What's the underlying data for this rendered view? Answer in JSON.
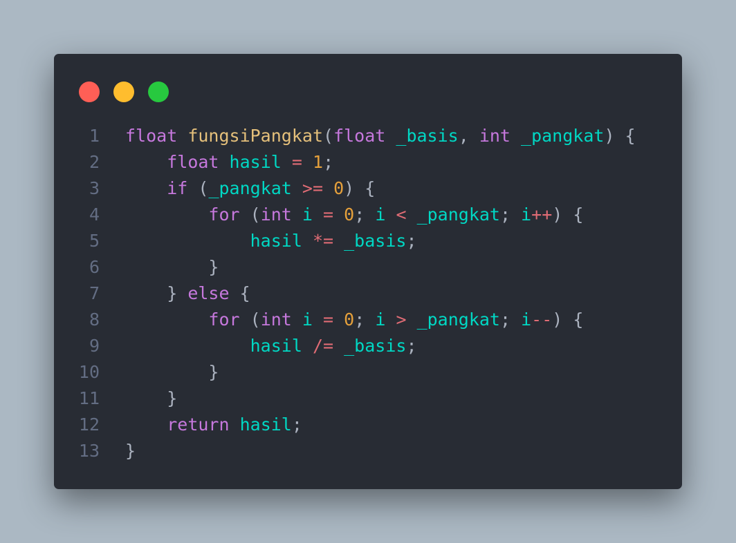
{
  "window": {
    "controls": [
      {
        "name": "close-button",
        "color": "#ff5f56"
      },
      {
        "name": "minimize-button",
        "color": "#ffbd2e"
      },
      {
        "name": "maximize-button",
        "color": "#27c93f"
      }
    ]
  },
  "colors": {
    "keyword": "#c678dd",
    "function": "#e5c07b",
    "identifier": "#00d8c4",
    "operator": "#e06c75",
    "number": "#e5a03b",
    "punct": "#abb2bf"
  },
  "code": {
    "lines": [
      {
        "n": "1",
        "tokens": [
          [
            "float",
            "keyword"
          ],
          [
            " ",
            "punct"
          ],
          [
            "fungsiPangkat",
            "function"
          ],
          [
            "(",
            "punct"
          ],
          [
            "float",
            "keyword"
          ],
          [
            " ",
            "punct"
          ],
          [
            "_basis",
            "identifier"
          ],
          [
            ", ",
            "punct"
          ],
          [
            "int",
            "keyword"
          ],
          [
            " ",
            "punct"
          ],
          [
            "_pangkat",
            "identifier"
          ],
          [
            ") {",
            "punct"
          ]
        ]
      },
      {
        "n": "2",
        "tokens": [
          [
            "    ",
            "punct"
          ],
          [
            "float",
            "keyword"
          ],
          [
            " ",
            "punct"
          ],
          [
            "hasil",
            "identifier"
          ],
          [
            " ",
            "punct"
          ],
          [
            "=",
            "operator"
          ],
          [
            " ",
            "punct"
          ],
          [
            "1",
            "number"
          ],
          [
            ";",
            "punct"
          ]
        ]
      },
      {
        "n": "3",
        "tokens": [
          [
            "    ",
            "punct"
          ],
          [
            "if",
            "keyword"
          ],
          [
            " (",
            "punct"
          ],
          [
            "_pangkat",
            "identifier"
          ],
          [
            " ",
            "punct"
          ],
          [
            ">=",
            "operator"
          ],
          [
            " ",
            "punct"
          ],
          [
            "0",
            "number"
          ],
          [
            ") {",
            "punct"
          ]
        ]
      },
      {
        "n": "4",
        "tokens": [
          [
            "        ",
            "punct"
          ],
          [
            "for",
            "keyword"
          ],
          [
            " (",
            "punct"
          ],
          [
            "int",
            "keyword"
          ],
          [
            " ",
            "punct"
          ],
          [
            "i",
            "identifier"
          ],
          [
            " ",
            "punct"
          ],
          [
            "=",
            "operator"
          ],
          [
            " ",
            "punct"
          ],
          [
            "0",
            "number"
          ],
          [
            "; ",
            "punct"
          ],
          [
            "i",
            "identifier"
          ],
          [
            " ",
            "punct"
          ],
          [
            "<",
            "operator"
          ],
          [
            " ",
            "punct"
          ],
          [
            "_pangkat",
            "identifier"
          ],
          [
            "; ",
            "punct"
          ],
          [
            "i",
            "identifier"
          ],
          [
            "++",
            "operator"
          ],
          [
            ") {",
            "punct"
          ]
        ]
      },
      {
        "n": "5",
        "tokens": [
          [
            "            ",
            "punct"
          ],
          [
            "hasil",
            "identifier"
          ],
          [
            " ",
            "punct"
          ],
          [
            "*=",
            "operator"
          ],
          [
            " ",
            "punct"
          ],
          [
            "_basis",
            "identifier"
          ],
          [
            ";",
            "punct"
          ]
        ]
      },
      {
        "n": "6",
        "tokens": [
          [
            "        ",
            "punct"
          ],
          [
            "}",
            "punct"
          ]
        ]
      },
      {
        "n": "7",
        "tokens": [
          [
            "    ",
            "punct"
          ],
          [
            "} ",
            "punct"
          ],
          [
            "else",
            "keyword"
          ],
          [
            " {",
            "punct"
          ]
        ]
      },
      {
        "n": "8",
        "tokens": [
          [
            "        ",
            "punct"
          ],
          [
            "for",
            "keyword"
          ],
          [
            " (",
            "punct"
          ],
          [
            "int",
            "keyword"
          ],
          [
            " ",
            "punct"
          ],
          [
            "i",
            "identifier"
          ],
          [
            " ",
            "punct"
          ],
          [
            "=",
            "operator"
          ],
          [
            " ",
            "punct"
          ],
          [
            "0",
            "number"
          ],
          [
            "; ",
            "punct"
          ],
          [
            "i",
            "identifier"
          ],
          [
            " ",
            "punct"
          ],
          [
            ">",
            "operator"
          ],
          [
            " ",
            "punct"
          ],
          [
            "_pangkat",
            "identifier"
          ],
          [
            "; ",
            "punct"
          ],
          [
            "i",
            "identifier"
          ],
          [
            "--",
            "operator"
          ],
          [
            ") {",
            "punct"
          ]
        ]
      },
      {
        "n": "9",
        "tokens": [
          [
            "            ",
            "punct"
          ],
          [
            "hasil",
            "identifier"
          ],
          [
            " ",
            "punct"
          ],
          [
            "/=",
            "operator"
          ],
          [
            " ",
            "punct"
          ],
          [
            "_basis",
            "identifier"
          ],
          [
            ";",
            "punct"
          ]
        ]
      },
      {
        "n": "10",
        "tokens": [
          [
            "        ",
            "punct"
          ],
          [
            "}",
            "punct"
          ]
        ]
      },
      {
        "n": "11",
        "tokens": [
          [
            "    ",
            "punct"
          ],
          [
            "}",
            "punct"
          ]
        ]
      },
      {
        "n": "12",
        "tokens": [
          [
            "    ",
            "punct"
          ],
          [
            "return",
            "keyword"
          ],
          [
            " ",
            "punct"
          ],
          [
            "hasil",
            "identifier"
          ],
          [
            ";",
            "punct"
          ]
        ]
      },
      {
        "n": "13",
        "tokens": [
          [
            "}",
            "punct"
          ]
        ]
      }
    ]
  }
}
